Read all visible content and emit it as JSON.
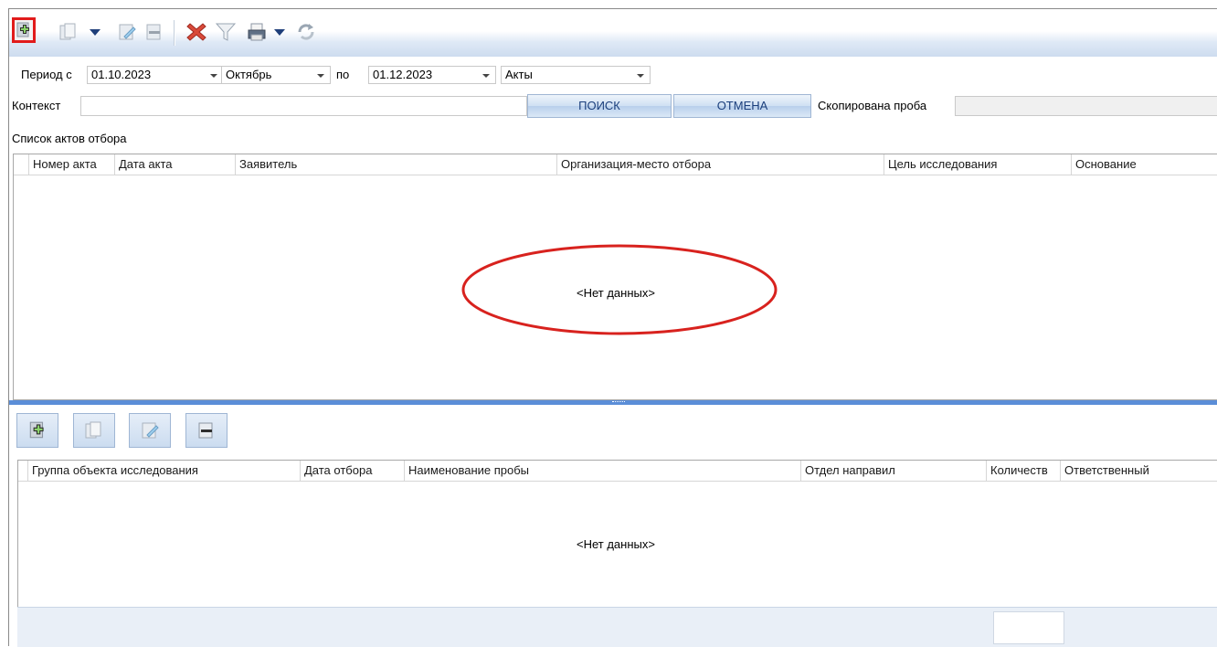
{
  "toolbar": {
    "icons": [
      "add-icon",
      "copy-icon",
      "dropdown-caret-icon",
      "edit-icon",
      "remove-icon",
      "delete-icon",
      "filter-icon",
      "print-icon",
      "dropdown-caret-icon",
      "refresh-icon"
    ]
  },
  "filters": {
    "period_label": "Период с",
    "date_from": "01.10.2023",
    "month": "Октябрь",
    "to_label": "по",
    "date_to": "01.12.2023",
    "doc_type": "Акты"
  },
  "search": {
    "context_label": "Контекст",
    "context_value": "",
    "search_button": "ПОИСК",
    "cancel_button": "ОТМЕНА",
    "copied_label": "Скопирована проба",
    "copied_value": ""
  },
  "acts": {
    "section_title": "Список актов отбора",
    "columns": [
      "Номер акта",
      "Дата акта",
      "Заявитель",
      "Организация-место отбора",
      "Цель исследования",
      "Основание"
    ],
    "no_data": "<Нет данных>"
  },
  "samples": {
    "columns": [
      "Группа объекта исследования",
      "Дата отбора",
      "Наименование пробы",
      "Отдел направил",
      "Количеств",
      "Ответственный"
    ],
    "no_data": "<Нет данных>"
  },
  "colors": {
    "highlight": "#e11b1b",
    "toolbar_gradient_end": "#cddcef",
    "splitter": "#5b8ed8",
    "button_text": "#1b3f7c"
  }
}
